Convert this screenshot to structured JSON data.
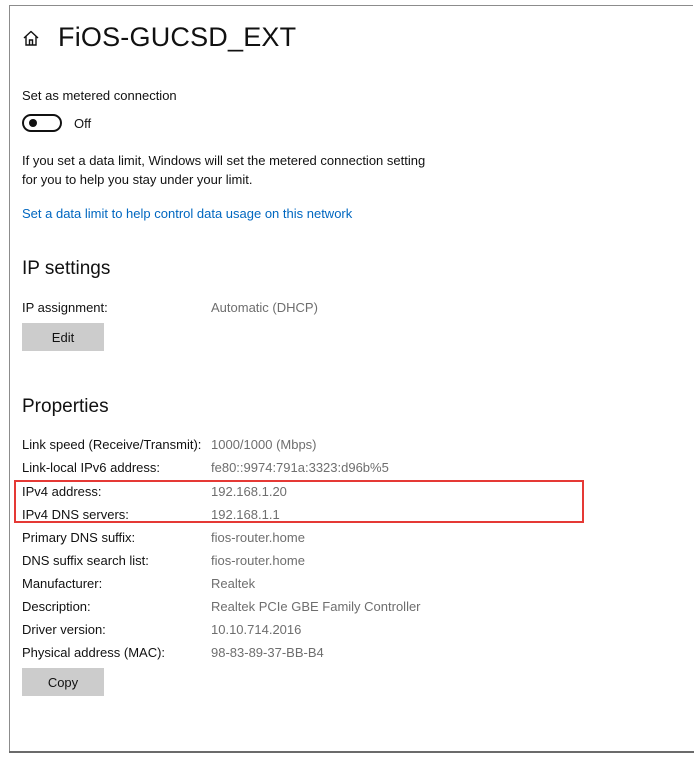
{
  "header": {
    "title": "FiOS-GUCSD_EXT",
    "home_icon": "home-icon"
  },
  "metered": {
    "label": "Set as metered connection",
    "toggle_state": "Off",
    "description": "If you set a data limit, Windows will set the metered connection setting for you to help you stay under your limit.",
    "data_limit_link": "Set a data limit to help control data usage on this network"
  },
  "ip_settings": {
    "heading": "IP settings",
    "assignment_label": "IP assignment:",
    "assignment_value": "Automatic (DHCP)",
    "edit_label": "Edit"
  },
  "properties": {
    "heading": "Properties",
    "rows": [
      {
        "key": "Link speed (Receive/Transmit):",
        "value": "1000/1000 (Mbps)"
      },
      {
        "key": "Link-local IPv6 address:",
        "value": "fe80::9974:791a:3323:d96b%5"
      },
      {
        "key": "IPv4 address:",
        "value": "192.168.1.20"
      },
      {
        "key": "IPv4 DNS servers:",
        "value": "192.168.1.1"
      },
      {
        "key": "Primary DNS suffix:",
        "value": "fios-router.home"
      },
      {
        "key": "DNS suffix search list:",
        "value": "fios-router.home"
      },
      {
        "key": "Manufacturer:",
        "value": "Realtek"
      },
      {
        "key": "Description:",
        "value": "Realtek PCIe GBE Family Controller"
      },
      {
        "key": "Driver version:",
        "value": "10.10.714.2016"
      },
      {
        "key": "Physical address (MAC):",
        "value": "98-83-89-37-BB-B4"
      }
    ],
    "copy_label": "Copy"
  },
  "colors": {
    "link": "#0067c0",
    "highlight": "#e53935",
    "button_bg": "#cccccc",
    "value_text": "#6e6e6e"
  }
}
